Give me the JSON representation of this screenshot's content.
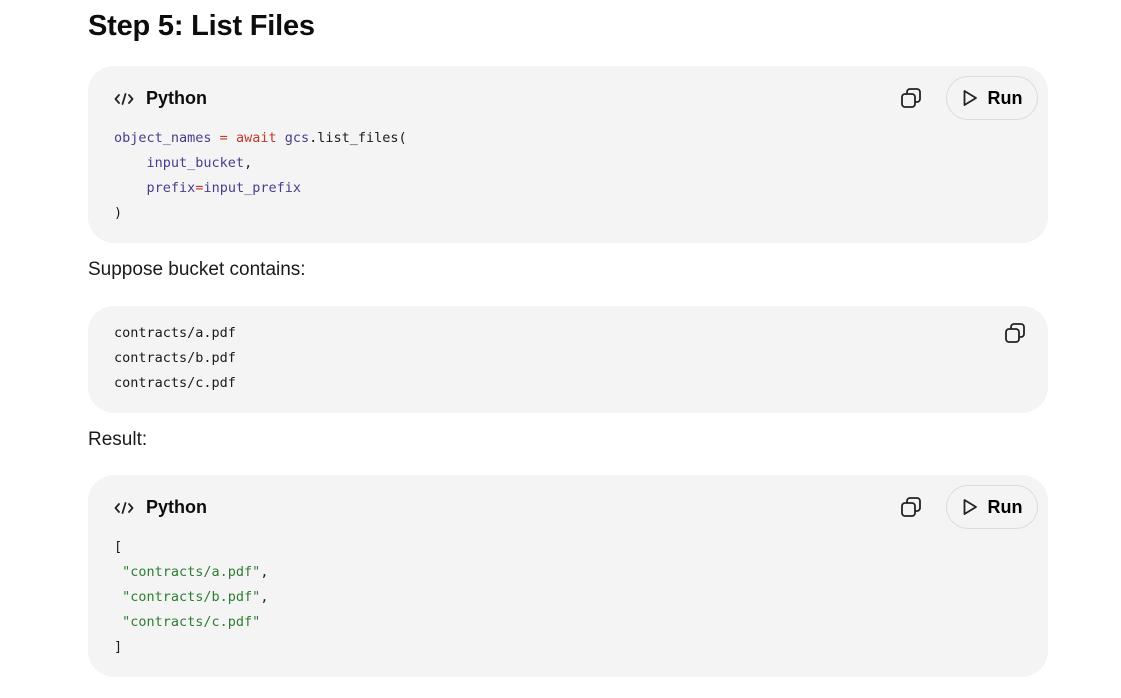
{
  "heading": "Step 5: List Files",
  "block1": {
    "language": "Python",
    "run_label": "Run",
    "code": {
      "l1_var": "object_names",
      "l1_eq": " = ",
      "l1_kw": "await",
      "l1_obj": " gcs",
      "l1_dot": ".",
      "l1_fn": "list_files(",
      "l2_indent": "    ",
      "l2_arg": "input_bucket",
      "l2_comma": ",",
      "l3_indent": "    ",
      "l3_kw": "prefix",
      "l3_eq": "=",
      "l3_val": "input_prefix",
      "l4": ")"
    }
  },
  "para1": "Suppose bucket contains:",
  "block2": {
    "lines": [
      "contracts/a.pdf",
      "contracts/b.pdf",
      "contracts/c.pdf"
    ]
  },
  "para2": "Result:",
  "block3": {
    "language": "Python",
    "run_label": "Run",
    "open": "[",
    "items": [
      "\"contracts/a.pdf\"",
      "\"contracts/b.pdf\"",
      "\"contracts/c.pdf\""
    ],
    "comma": ",",
    "close": "]"
  },
  "icons": {
    "code": "code-icon",
    "copy": "copy-icon",
    "play": "play-icon"
  }
}
